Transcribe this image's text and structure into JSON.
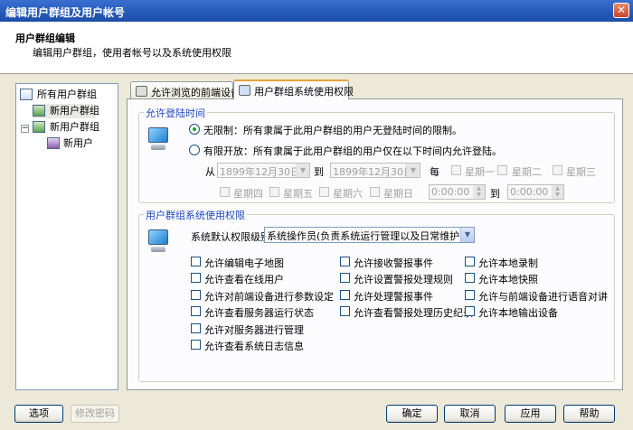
{
  "window": {
    "title": "编辑用户群组及用户帐号",
    "close_symbol": "✕"
  },
  "header": {
    "title": "用户群组编辑",
    "subtitle": "编辑用户群组，使用者帐号以及系统使用权限"
  },
  "tree": {
    "root": "所有用户群组",
    "items": [
      {
        "label": "新用户群组"
      },
      {
        "label": "新用户群组"
      },
      {
        "label": "新用户"
      }
    ]
  },
  "tabs": [
    {
      "label": "允许浏览的前端设备"
    },
    {
      "label": "用户群组系统使用权限"
    }
  ],
  "login_time": {
    "group_label": "允许登陆时间",
    "opt_unlimited": "无限制：所有隶属于此用户群组的用户无登陆时间的限制。",
    "opt_limited": "有限开放：所有隶属于此用户群组的用户仅在以下时间内允许登陆。",
    "from_label": "从",
    "to_label": "到",
    "date_from": "1899年12月30日",
    "date_to": "1899年12月30日",
    "every_label": "每",
    "days": [
      "星期一",
      "星期二",
      "星期三",
      "星期四",
      "星期五",
      "星期六",
      "星期日"
    ],
    "time_from": "0:00:00",
    "time_to_label": "到",
    "time_to": "0:00:00"
  },
  "permissions": {
    "group_label": "用户群组系统使用权限",
    "level_label": "系统默认权限级别",
    "level_value": "系统操作员(负责系统运行管理以及日常维护)",
    "col1": [
      "允许编辑电子地图",
      "允许查看在线用户",
      "允许对前端设备进行参数设定",
      "允许查看服务器运行状态",
      "允许对服务器进行管理",
      "允许查看系统日志信息"
    ],
    "col2": [
      "允许接收警报事件",
      "允许设置警报处理规则",
      "允许处理警报事件",
      "允许查看警报处理历史纪录"
    ],
    "col3": [
      "允许本地录制",
      "允许本地快照",
      "允许与前端设备进行语音对讲",
      "允许本地输出设备"
    ]
  },
  "buttons": {
    "options": "选项",
    "change_password": "修改密码",
    "ok": "确定",
    "cancel": "取消",
    "apply": "应用",
    "help": "帮助"
  }
}
